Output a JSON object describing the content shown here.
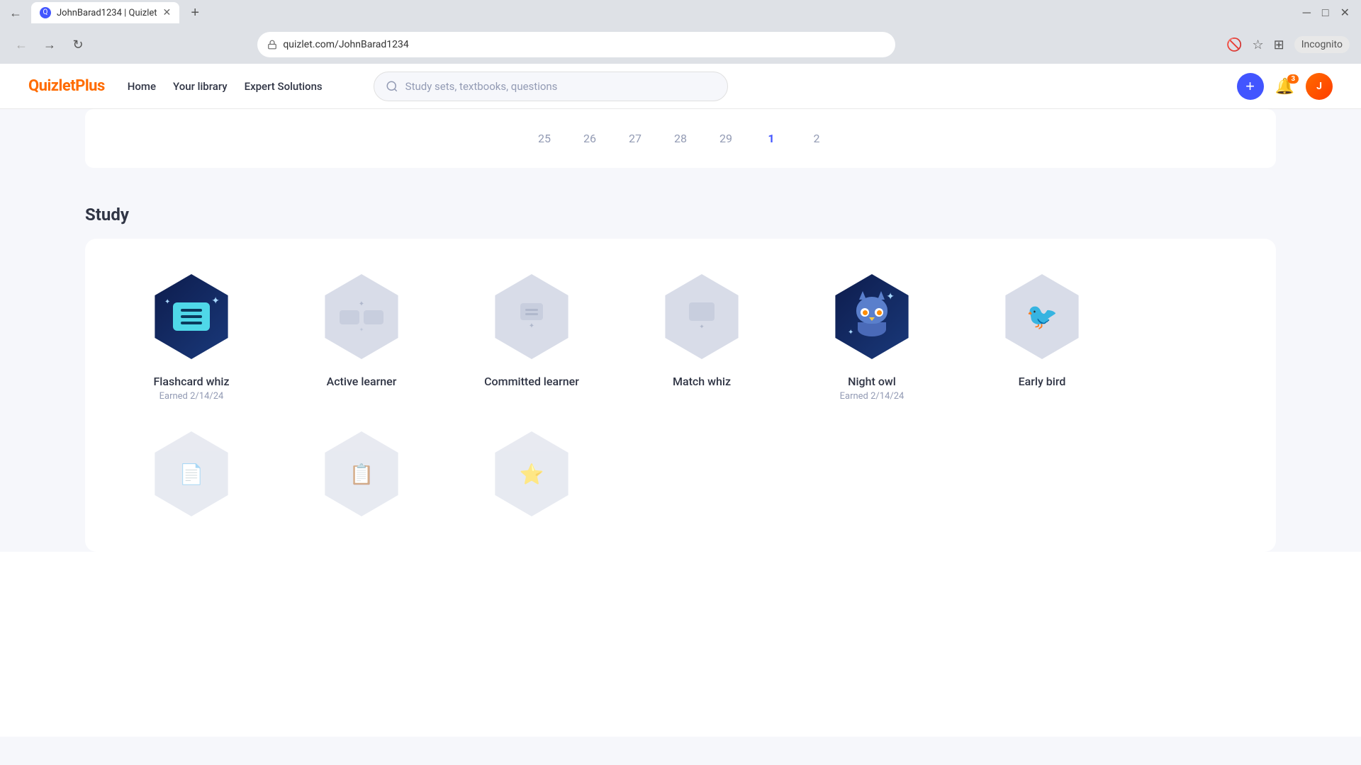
{
  "browser": {
    "tab_title": "JohnBarad1234 | Quizlet",
    "url": "quizlet.com/JohnBarad1234",
    "new_tab_label": "+",
    "window_controls": [
      "─",
      "□",
      "✕"
    ]
  },
  "nav": {
    "logo": "QuizletPlus",
    "links": [
      "Home",
      "Your library",
      "Expert Solutions"
    ],
    "search_placeholder": "Study sets, textbooks, questions",
    "notification_badge": "3",
    "create_icon": "+"
  },
  "calendar": {
    "days": [
      "25",
      "26",
      "27",
      "28",
      "29",
      "1",
      "2"
    ]
  },
  "study_section": {
    "title": "Study",
    "badges": [
      {
        "id": "flashcard-whiz",
        "label": "Flashcard whiz",
        "earned": true,
        "earned_date": "Earned 2/14/24",
        "color": "earned"
      },
      {
        "id": "active-learner",
        "label": "Active learner",
        "earned": false,
        "earned_date": "",
        "color": "unearned"
      },
      {
        "id": "committed-learner",
        "label": "Committed learner",
        "earned": false,
        "earned_date": "",
        "color": "unearned"
      },
      {
        "id": "match-whiz",
        "label": "Match whiz",
        "earned": false,
        "earned_date": "",
        "color": "unearned"
      },
      {
        "id": "night-owl",
        "label": "Night owl",
        "earned": true,
        "earned_date": "Earned 2/14/24",
        "color": "earned"
      },
      {
        "id": "early-bird",
        "label": "Early bird",
        "earned": false,
        "earned_date": "",
        "color": "unearned"
      }
    ],
    "badges_row2": [
      {
        "id": "badge-r2-1",
        "label": "",
        "earned": false
      },
      {
        "id": "badge-r2-2",
        "label": "",
        "earned": false
      },
      {
        "id": "badge-r2-3",
        "label": "",
        "earned": false
      }
    ]
  }
}
